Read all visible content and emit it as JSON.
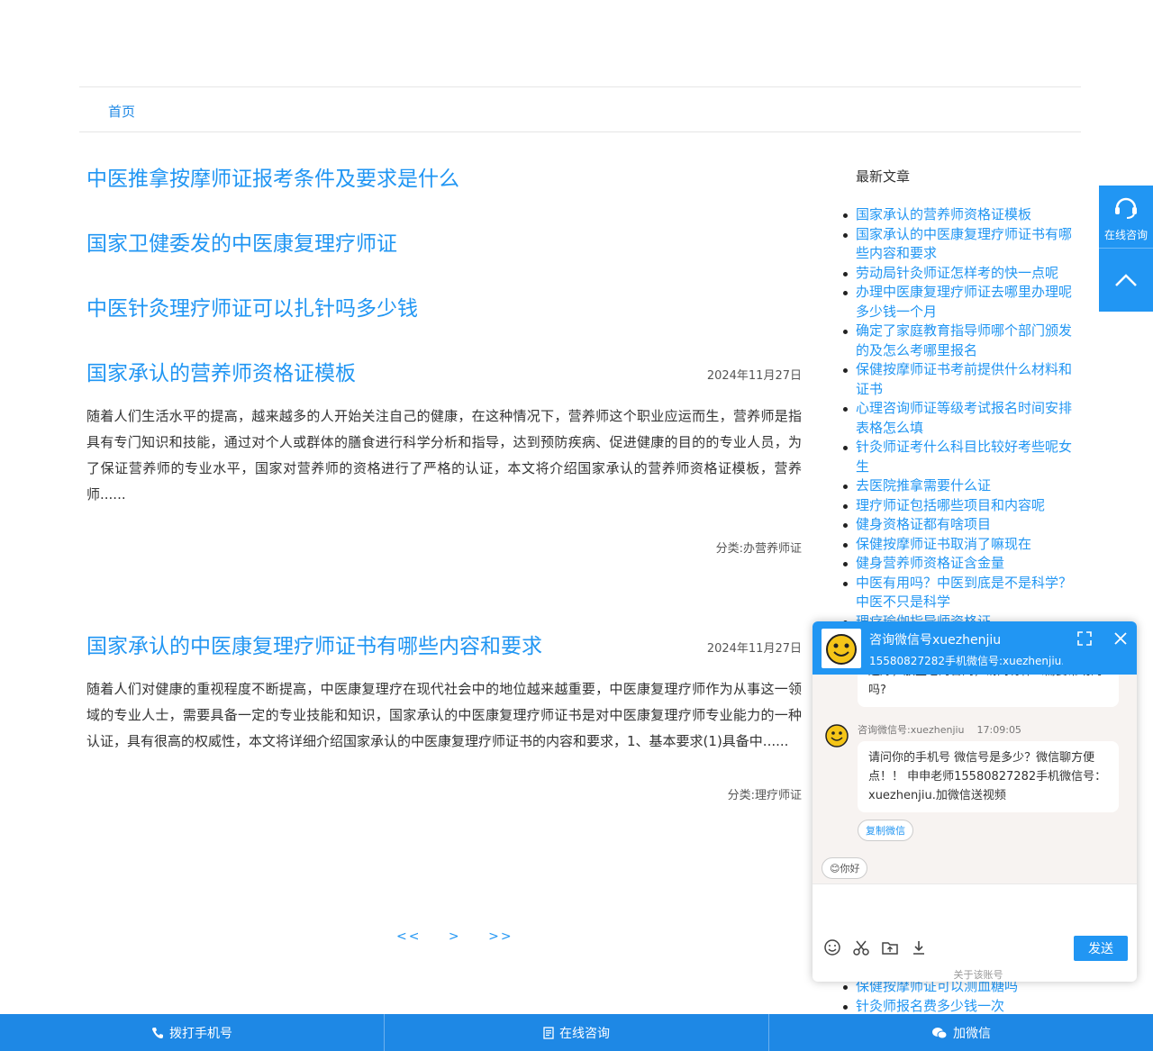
{
  "nav": {
    "home": "首页"
  },
  "top_titles": [
    "中医推拿按摩师证报考条件及要求是什么",
    "国家卫健委发的中医康复理疗师证",
    "中医针灸理疗师证可以扎针吗多少钱"
  ],
  "articles": [
    {
      "title": "国家承认的营养师资格证模板",
      "date": "2024年11月27日",
      "summary": "随着人们生活水平的提高，越来越多的人开始关注自己的健康，在这种情况下，营养师这个职业应运而生，营养师是指具有专门知识和技能，通过对个人或群体的膳食进行科学分析和指导，达到预防疾病、促进健康的目的的专业人员，为了保证营养师的专业水平，国家对营养师的资格进行了严格的认证，本文将介绍国家承认的营养师资格证模板，营养师......",
      "category": "分类:办营养师证"
    },
    {
      "title": "国家承认的中医康复理疗师证书有哪些内容和要求",
      "date": "2024年11月27日",
      "summary": "随着人们对健康的重视程度不断提高，中医康复理疗在现代社会中的地位越来越重要，中医康复理疗师作为从事这一领域的专业人士，需要具备一定的专业技能和知识，国家承认的中医康复理疗师证书是对中医康复理疗师专业能力的一种认证，具有很高的权威性，本文将详细介绍国家承认的中医康复理疗师证书的内容和要求，1、基本要求(1)具备中......",
      "category": "分类:理疗师证"
    }
  ],
  "pager": {
    "first": "<<",
    "next": ">",
    "last": ">>"
  },
  "sidebar": {
    "title": "最新文章",
    "items": [
      "国家承认的营养师资格证模板",
      "国家承认的中医康复理疗师证书有哪些内容和要求",
      "劳动局针灸师证怎样考的快一点呢",
      "办理中医康复理疗师证去哪里办理呢多少钱一个月",
      "确定了家庭教育指导师哪个部门颁发的及怎么考哪里报名",
      "保健按摩师证书考前提供什么材料和证书",
      "心理咨询师证等级考试报名时间安排表格怎么填",
      "针灸师证考什么科目比较好考些呢女生",
      "去医院推拿需要什么证",
      "理疗师证包括哪些项目和内容呢",
      "健身资格证都有啥项目",
      "保健按摩师证书取消了嘛现在",
      "健身营养师资格证含金量",
      "中医有用吗？中医到底是不是科学？中医不只是科学",
      "理疗瑜伽指导师资格证"
    ],
    "tail_items": [
      "保健按摩师证可以测血糖吗",
      "针灸师报名费多少钱一次"
    ]
  },
  "float_bar": {
    "consult_label": "在线咨询"
  },
  "chat": {
    "name": "咨询微信号xuezhenjiu",
    "subtitle": "15580827282手机微信号:xuezhenjiu.加...",
    "msg1": "还好，放些老的合同，请问有什么需要帮助的吗?",
    "sender": "咨询微信号:xuezhenjiu",
    "time": "17:09:05",
    "msg2": "请问你的手机号 微信号是多少？微信聊方便点！！ 申申老师15580827282手机微信号：xuezhenjiu.加微信送视频",
    "copy_btn": "复制微信",
    "quick_reply": "😊你好",
    "send": "发送",
    "about": "关于该账号"
  },
  "bottom_bar": {
    "call": "拨打手机号",
    "consult": "在线咨询",
    "wechat": "加微信"
  },
  "colors": {
    "accent": "#2196f3",
    "bottom_bar": "#1e88e5"
  }
}
